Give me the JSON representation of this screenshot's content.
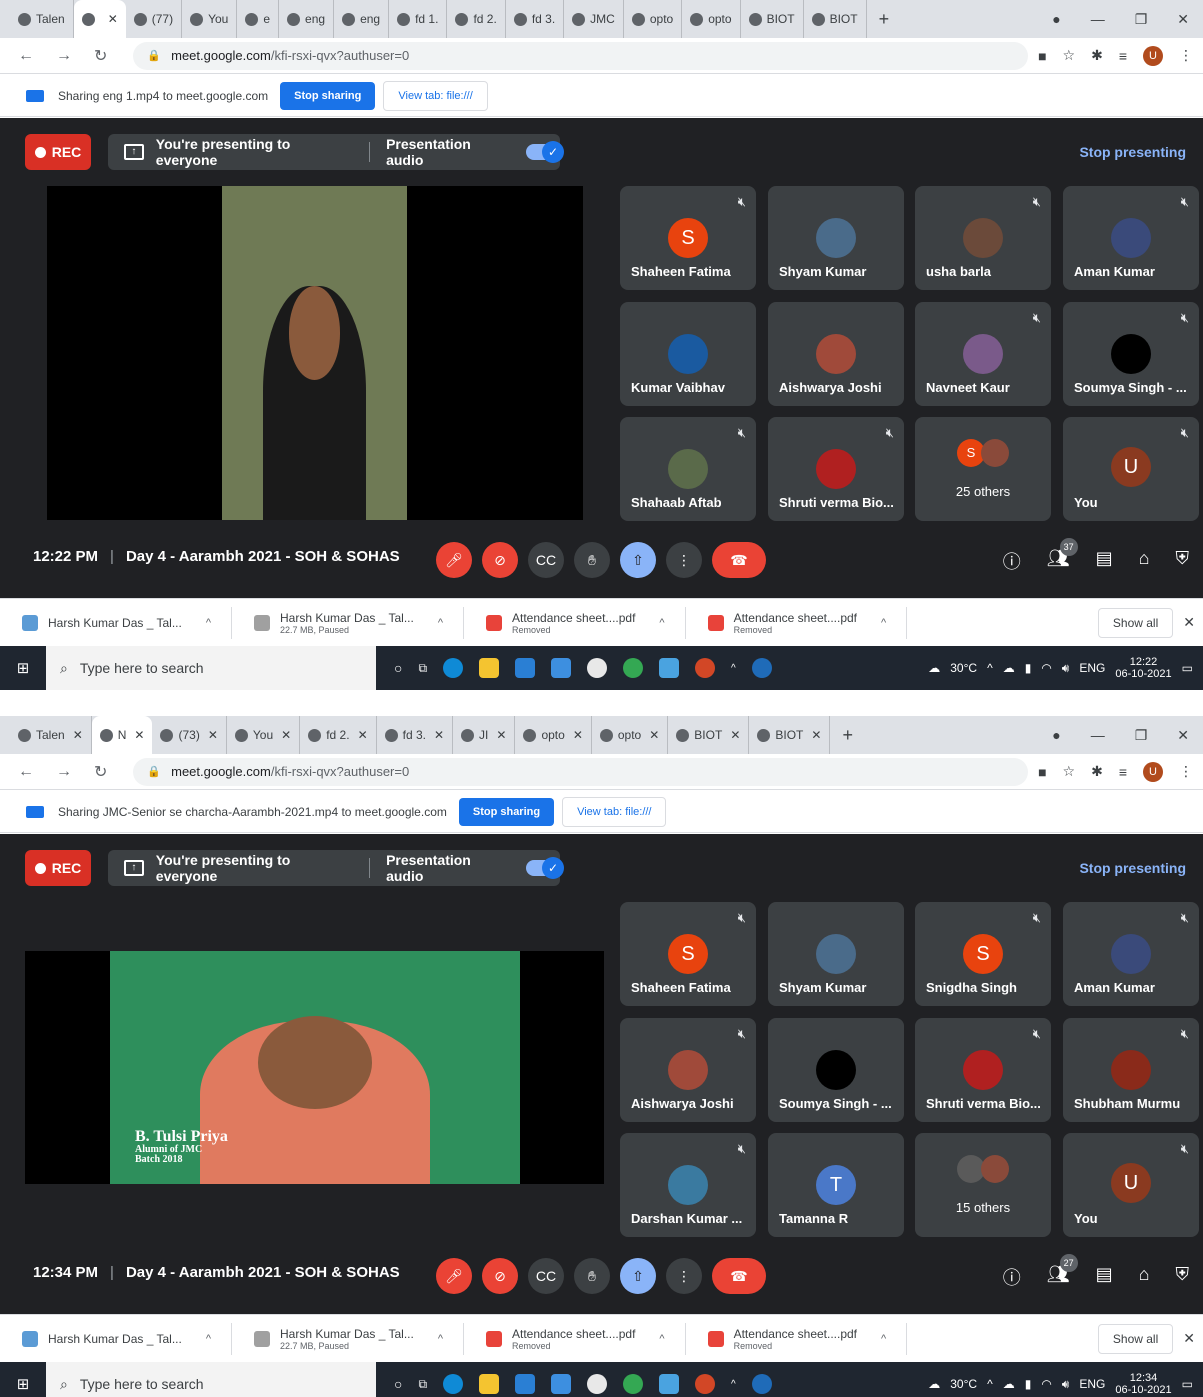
{
  "screens": [
    {
      "tabs": [
        "Talen",
        "",
        "(77)",
        "You",
        "e",
        "eng",
        "eng",
        "fd 1.",
        "fd 2.",
        "fd 3.",
        "JMC",
        "opto",
        "opto",
        "BIOT",
        "BIOT"
      ],
      "url_host": "meet.google.com",
      "url_path": "/kfi-rsxi-qvx?authuser=0",
      "share_text": "Sharing eng 1.mp4 to meet.google.com",
      "stop_sharing": "Stop sharing",
      "view_tab": "View tab: file:///",
      "rec": "REC",
      "presenting": "You're presenting to everyone",
      "presentation_audio": "Presentation audio",
      "stop_presenting": "Stop presenting",
      "participants": [
        {
          "name": "Shaheen Fatima",
          "initial": "S",
          "color": "#e8430e"
        },
        {
          "name": "Shyam Kumar",
          "initial": "",
          "color": "#4a6b8a"
        },
        {
          "name": "usha barla",
          "initial": "",
          "color": "#6b4a3a"
        },
        {
          "name": "Aman Kumar",
          "initial": "",
          "color": "#3a4a7a"
        },
        {
          "name": "Kumar Vaibhav",
          "initial": "",
          "color": "#1a5aa0"
        },
        {
          "name": "Aishwarya Joshi",
          "initial": "",
          "color": "#a04a3a"
        },
        {
          "name": "Navneet Kaur",
          "initial": "",
          "color": "#7a5a8a"
        },
        {
          "name": "Soumya Singh - ...",
          "initial": "",
          "color": "#000000"
        },
        {
          "name": "Shahaab Aftab",
          "initial": "",
          "color": "#5a6a4a"
        },
        {
          "name": "Shruti verma Bio...",
          "initial": "",
          "color": "#b02020"
        },
        {
          "name": "25 others",
          "initial": "",
          "color": ""
        },
        {
          "name": "You",
          "initial": "U",
          "color": "#8a3a20"
        }
      ],
      "others_minis": [
        "S",
        ""
      ],
      "clock": "12:22 PM",
      "meeting_title": "Day 4 - Aarambh 2021 - SOH & SOHAS",
      "people_count": "37",
      "caption": null,
      "downloads": [
        {
          "name": "Harsh Kumar Das _ Tal...",
          "sub": ""
        },
        {
          "name": "Harsh Kumar Das _ Tal...",
          "sub": "22.7 MB, Paused"
        },
        {
          "name": "Attendance sheet....pdf",
          "sub": "Removed"
        },
        {
          "name": "Attendance sheet....pdf",
          "sub": "Removed"
        }
      ],
      "show_all": "Show all",
      "search_placeholder": "Type here to search",
      "weather": "30°C",
      "lang": "ENG",
      "tray_time": "12:22",
      "tray_date": "06-10-2021"
    },
    {
      "tabs": [
        "Talen",
        "N",
        "(73)",
        "You",
        "fd 2.",
        "fd 3.",
        "JI",
        "opto",
        "opto",
        "BIOT",
        "BIOT"
      ],
      "url_host": "meet.google.com",
      "url_path": "/kfi-rsxi-qvx?authuser=0",
      "share_text": "Sharing JMC-Senior se charcha-Aarambh-2021.mp4 to meet.google.com",
      "stop_sharing": "Stop sharing",
      "view_tab": "View tab: file:///",
      "rec": "REC",
      "presenting": "You're presenting to everyone",
      "presentation_audio": "Presentation audio",
      "stop_presenting": "Stop presenting",
      "participants": [
        {
          "name": "Shaheen Fatima",
          "initial": "S",
          "color": "#e8430e"
        },
        {
          "name": "Shyam Kumar",
          "initial": "",
          "color": "#4a6b8a"
        },
        {
          "name": "Snigdha Singh",
          "initial": "S",
          "color": "#e8430e"
        },
        {
          "name": "Aman Kumar",
          "initial": "",
          "color": "#3a4a7a"
        },
        {
          "name": "Aishwarya Joshi",
          "initial": "",
          "color": "#a04a3a"
        },
        {
          "name": "Soumya Singh - ...",
          "initial": "",
          "color": "#000000"
        },
        {
          "name": "Shruti verma Bio...",
          "initial": "",
          "color": "#b02020"
        },
        {
          "name": "Shubham Murmu",
          "initial": "",
          "color": "#8a2a1a"
        },
        {
          "name": "Darshan Kumar ...",
          "initial": "",
          "color": "#3a7aa0"
        },
        {
          "name": "Tamanna R",
          "initial": "T",
          "color": "#4a78c8"
        },
        {
          "name": "15 others",
          "initial": "",
          "color": ""
        },
        {
          "name": "You",
          "initial": "U",
          "color": "#8a3a20"
        }
      ],
      "others_minis": [
        "",
        ""
      ],
      "clock": "12:34 PM",
      "meeting_title": "Day 4 - Aarambh 2021 - SOH & SOHAS",
      "people_count": "27",
      "caption": {
        "name": "B. Tulsi Priya",
        "line2": "Alumni of JMC",
        "line3": "Batch 2018"
      },
      "downloads": [
        {
          "name": "Harsh Kumar Das _ Tal...",
          "sub": ""
        },
        {
          "name": "Harsh Kumar Das _ Tal...",
          "sub": "22.7 MB, Paused"
        },
        {
          "name": "Attendance sheet....pdf",
          "sub": "Removed"
        },
        {
          "name": "Attendance sheet....pdf",
          "sub": "Removed"
        }
      ],
      "show_all": "Show all",
      "search_placeholder": "Type here to search",
      "weather": "30°C",
      "lang": "ENG",
      "tray_time": "12:34",
      "tray_date": "06-10-2021"
    }
  ]
}
